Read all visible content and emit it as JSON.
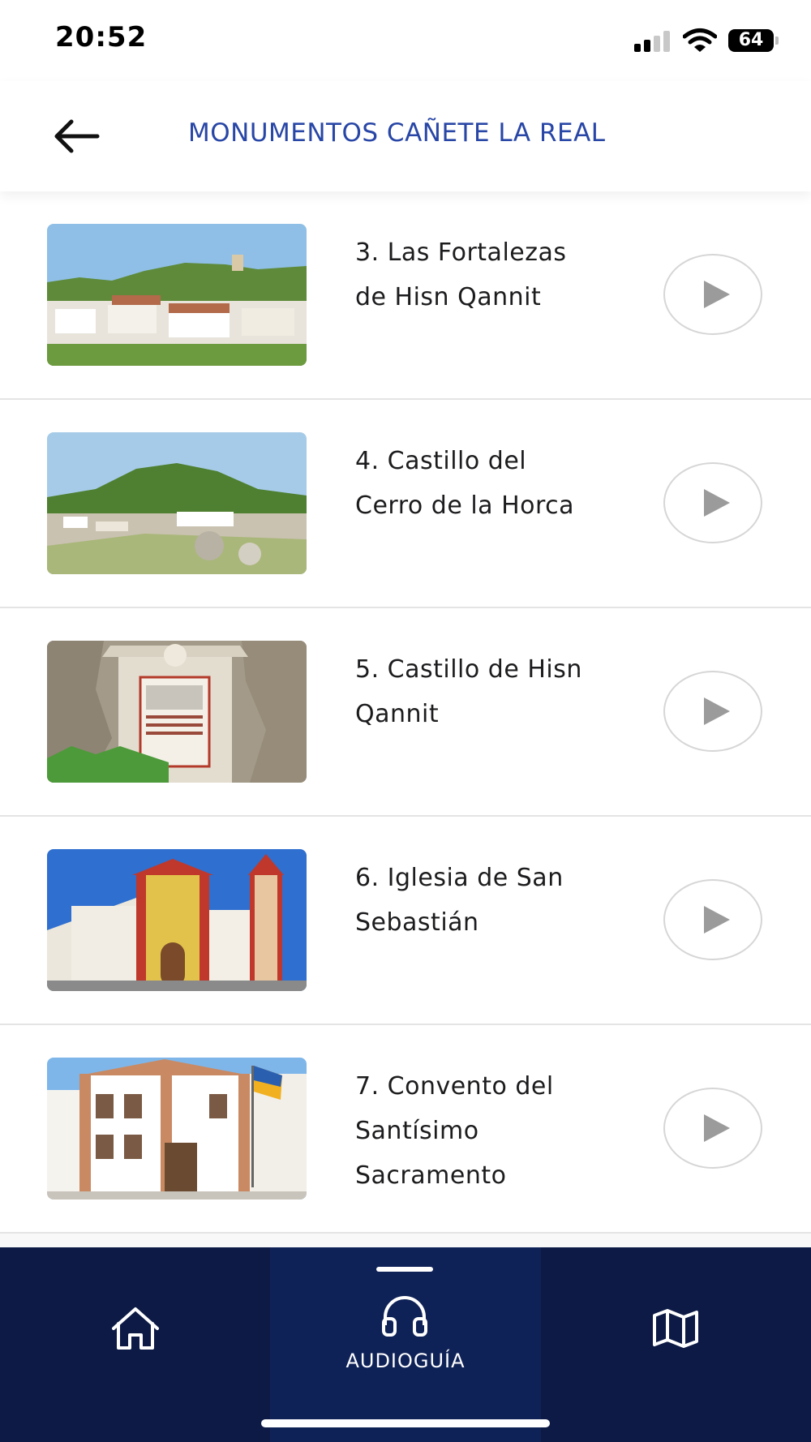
{
  "status_bar": {
    "time": "20:52",
    "battery": "64"
  },
  "header": {
    "title": "MONUMENTOS CAÑETE LA REAL"
  },
  "list": {
    "items": [
      {
        "line1": "3. Las Fortalezas",
        "line2": "de Hisn Qannit",
        "line3": ""
      },
      {
        "line1": "4. Castillo del",
        "line2": "Cerro de la Horca",
        "line3": ""
      },
      {
        "line1": "5. Castillo de Hisn",
        "line2": "Qannit",
        "line3": ""
      },
      {
        "line1": "6. Iglesia de San",
        "line2": "Sebastián",
        "line3": ""
      },
      {
        "line1": "7. Convento del",
        "line2": "Santísimo",
        "line3": "Sacramento"
      }
    ]
  },
  "tab_bar": {
    "tabs": [
      {
        "icon": "home-icon",
        "label": ""
      },
      {
        "icon": "headphones-icon",
        "label": "AUDIOGUÍA"
      },
      {
        "icon": "map-icon",
        "label": ""
      }
    ],
    "active_index": 1
  },
  "colors": {
    "accent": "#2846a6",
    "tabbar_bg": "#0c1a45",
    "tab_active_bg": "#0f2257"
  }
}
